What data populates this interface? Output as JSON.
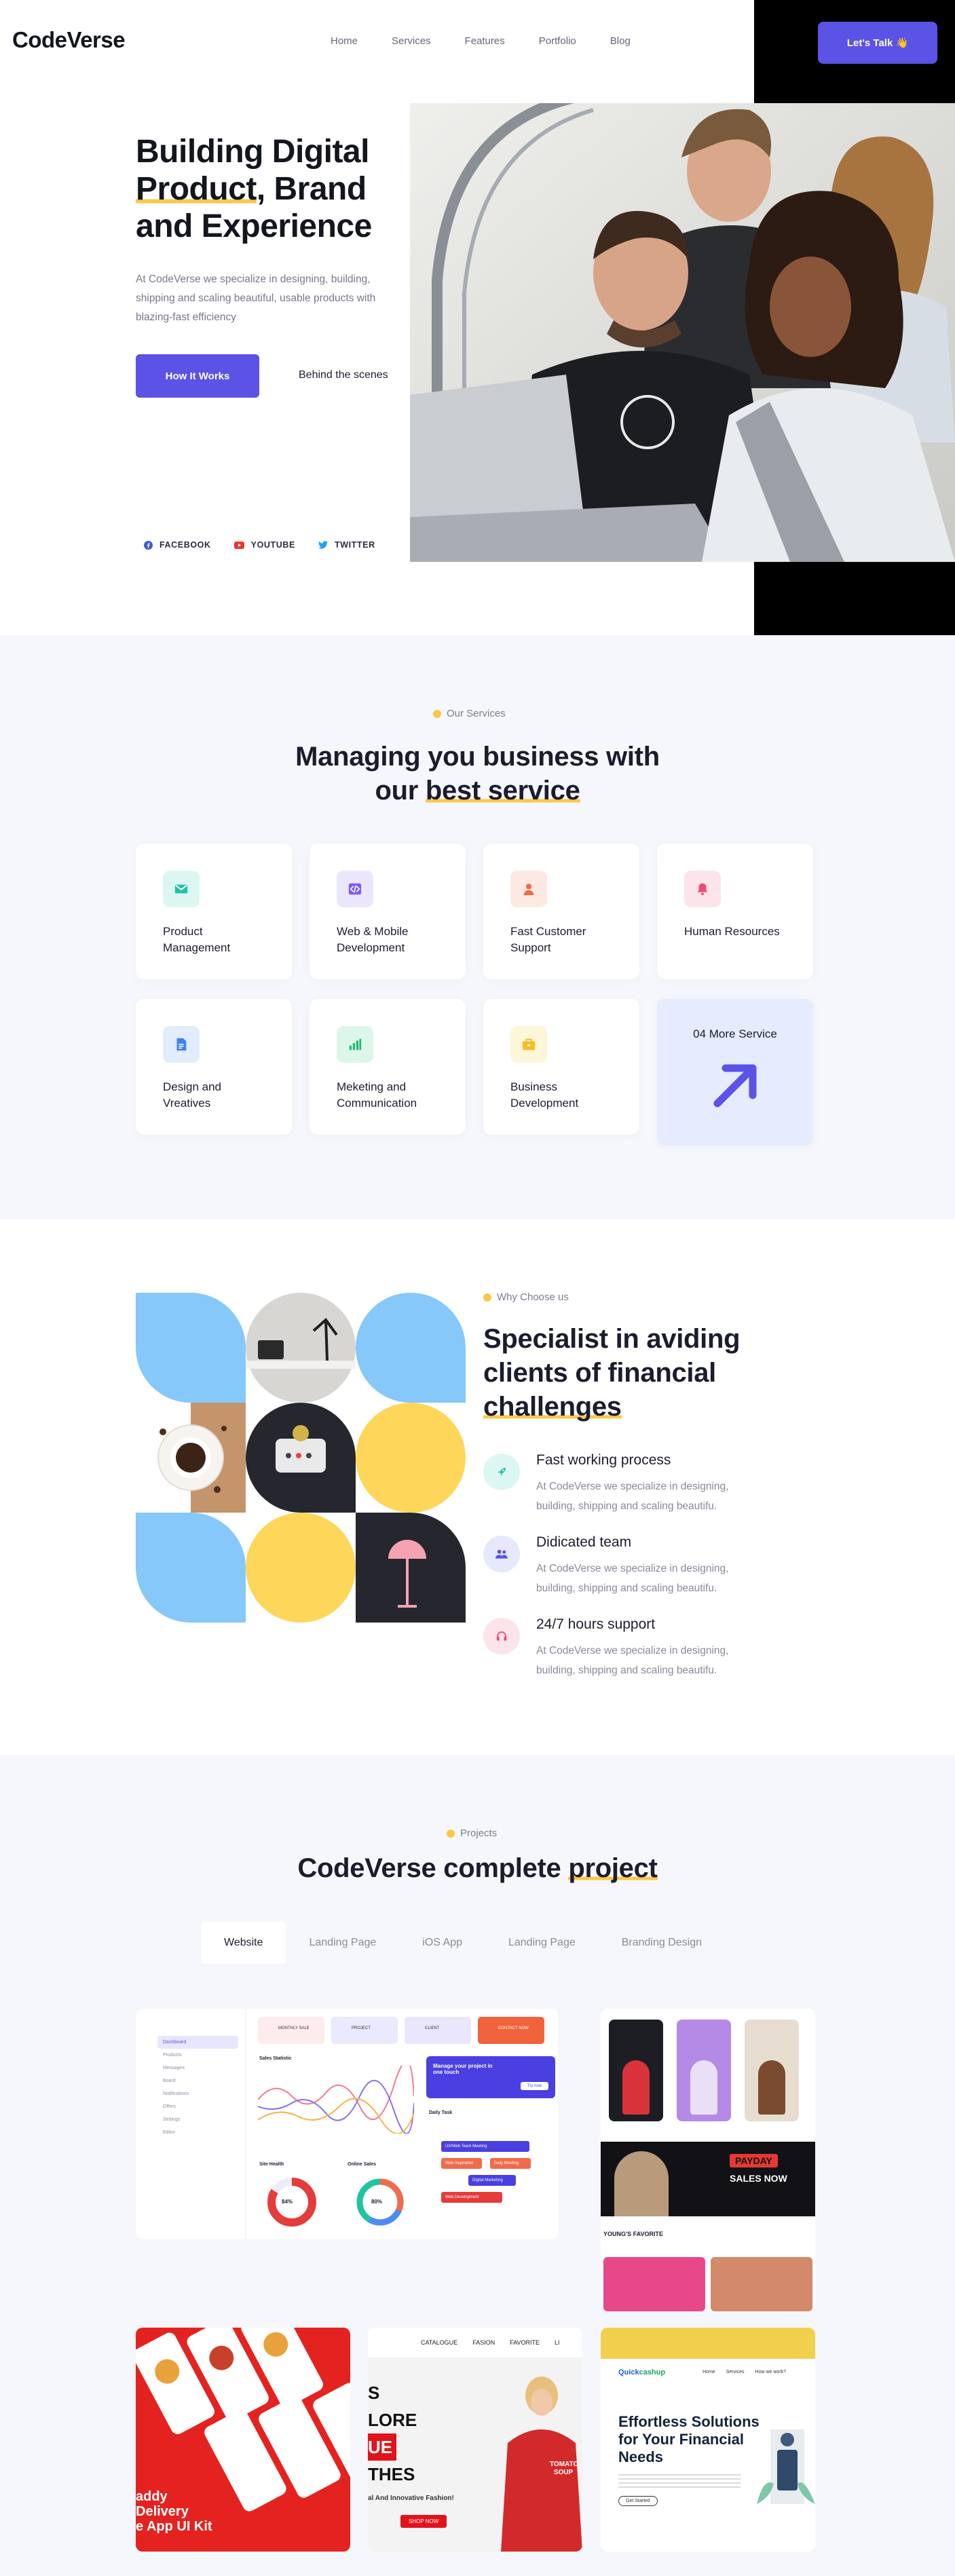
{
  "header": {
    "logo": "CodeVerse",
    "nav": [
      "Home",
      "Services",
      "Features",
      "Portfolio",
      "Blog"
    ],
    "cta": "Let's Talk 👋"
  },
  "hero": {
    "title_line1": "Building Digital",
    "title_hl": "Product",
    "title_rest1": ", Brand",
    "title_line3": "and Experience",
    "description": "At CodeVerse we specialize in designing, building, shipping and scaling beautiful, usable products with blazing-fast efficiency",
    "primary_button": "How It Works",
    "secondary_link": "Behind the scenes",
    "social": [
      {
        "label": "FACEBOOK",
        "color": "#3b5bdb"
      },
      {
        "label": "YOUTUBE",
        "color": "#e53935"
      },
      {
        "label": "TWITTER",
        "color": "#1da1f2"
      }
    ]
  },
  "services": {
    "eyebrow": "Our Services",
    "title_line1": "Managing you business with",
    "title_pre": "our ",
    "title_hl": "best service",
    "items": [
      {
        "label": "Product Management",
        "icon": "mail-icon",
        "bg": "#dcf7f2",
        "fg": "#22c1a5"
      },
      {
        "label": "Web & Mobile Development",
        "icon": "code-icon",
        "bg": "#ece6fd",
        "fg": "#7c5cf0"
      },
      {
        "label": "Fast Customer Support",
        "icon": "support-agent-icon",
        "bg": "#fde8e2",
        "fg": "#f06b4c"
      },
      {
        "label": "Human Resources",
        "icon": "bell-icon",
        "bg": "#fde3ea",
        "fg": "#ef4a73"
      },
      {
        "label": "Design and Vreatives",
        "icon": "document-icon",
        "bg": "#e1ecfd",
        "fg": "#3b82f6"
      },
      {
        "label": "Meketing and Communication",
        "icon": "bar-chart-icon",
        "bg": "#dcf7ea",
        "fg": "#22b873"
      },
      {
        "label": "Business Development",
        "icon": "briefcase-icon",
        "bg": "#fdf6d9",
        "fg": "#f3bf22"
      }
    ],
    "more_label": "04 More Service"
  },
  "why": {
    "eyebrow": "Why Choose us",
    "title_line1": "Specialist in aviding",
    "title_line2": "clients of financial",
    "title_hl": "challenges",
    "features": [
      {
        "title": "Fast working process",
        "desc": "At CodeVerse we specialize in designing, building, shipping and scaling beautifu.",
        "icon": "rocket-icon",
        "bg": "#dcf7f2",
        "fg": "#22c1a5"
      },
      {
        "title": "Didicated team",
        "desc": "At CodeVerse we specialize in designing, building, shipping and scaling beautifu.",
        "icon": "team-icon",
        "bg": "#e6e8fb",
        "fg": "#5b52e6"
      },
      {
        "title": "24/7 hours support",
        "desc": "At CodeVerse we specialize in designing, building, shipping and scaling beautifu.",
        "icon": "headphones-icon",
        "bg": "#fde3ea",
        "fg": "#ef4a73"
      }
    ]
  },
  "projects": {
    "eyebrow": "Projects",
    "title_pre": "CodeVerse complete ",
    "title_hl": "project",
    "tabs": [
      "Website",
      "Landing Page",
      "iOS App",
      "Landing Page",
      "Branding Design"
    ],
    "active_tab": "Website",
    "dashboard": {
      "sidebar": [
        "Dashboard",
        "Products",
        "Messages",
        "Board",
        "Notifications",
        "Offers",
        "Settings",
        "Editor"
      ],
      "stats": [
        "MONTHLY SALE",
        "PROJECT",
        "CLIENT",
        "CONTACT NOW"
      ],
      "chart_title": "Sales Statistic",
      "panel_title": "Manage your project in one touch",
      "panel_button": "Try now",
      "cards": [
        "Site Health",
        "Online Sales",
        "Daily Task"
      ],
      "percent1": "84%",
      "percent2": "80%",
      "tasks": [
        "UX/Web Team Meeting",
        "Web Inspiration",
        "Daily Meeting",
        "Digital Marketing",
        "Web Development"
      ]
    },
    "fashion": {
      "sale_brand": "PAYDAY",
      "sale_text": "SALES NOW",
      "section": "YOUNG'S FAVORITE"
    },
    "food": {
      "line1": "addy",
      "line2": "Delivery",
      "line3": "e App UI Kit"
    },
    "apparel": {
      "nav": [
        "CATALOGUE",
        "FASION",
        "FAVORITE",
        "LI"
      ],
      "lines": [
        "S",
        "LORE",
        "UE",
        "THES"
      ],
      "tagline": "al And Innovative Fashion!",
      "button": "SHOP NOW",
      "shirt": "TOMATO SOUP"
    },
    "finance": {
      "brand_pre": "Quick",
      "brand_post": "cashup",
      "nav": [
        "Home",
        "Services",
        "How we work?"
      ],
      "heading": "Effortless Solutions for Your Financial Needs",
      "button": "Get Started"
    }
  }
}
